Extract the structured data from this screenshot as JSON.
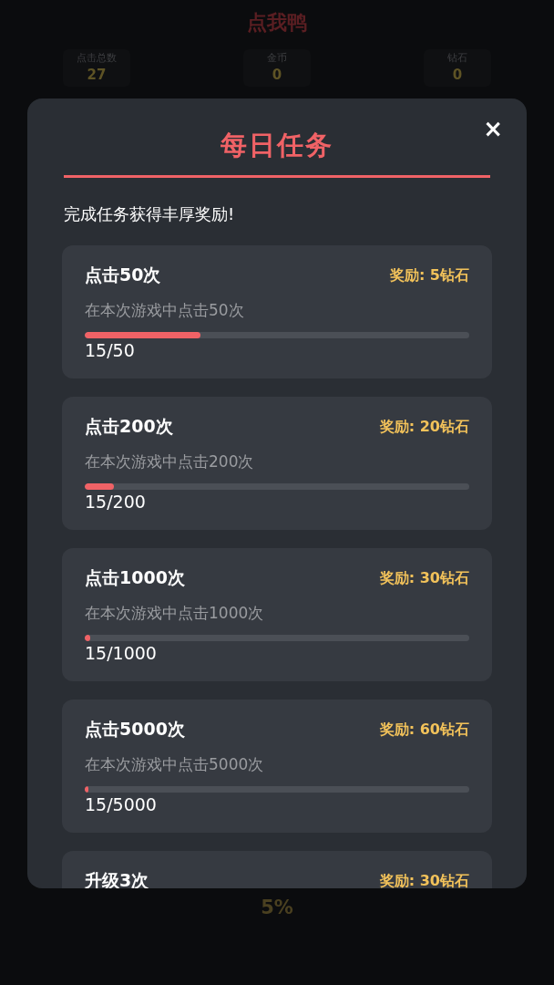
{
  "app_title": "点我鸭",
  "stats": [
    {
      "label": "点击总数",
      "value": "27"
    },
    {
      "label": "金币",
      "value": "0"
    },
    {
      "label": "钻石",
      "value": "0"
    }
  ],
  "progress_label": "5%",
  "modal": {
    "title": "每日任务",
    "close": "×",
    "subtitle": "完成任务获得丰厚奖励!",
    "tasks": [
      {
        "title": "点击50次",
        "reward": "奖励: 5钻石",
        "description": "在本次游戏中点击50次",
        "level": 0.3,
        "count": "15/50"
      },
      {
        "title": "点击200次",
        "reward": "奖励: 20钻石",
        "description": "在本次游戏中点击200次",
        "level": 0.075,
        "count": "15/200"
      },
      {
        "title": "点击1000次",
        "reward": "奖励: 30钻石",
        "description": "在本次游戏中点击1000次",
        "level": 0.015,
        "count": "15/1000"
      },
      {
        "title": "点击5000次",
        "reward": "奖励: 60钻石",
        "description": "在本次游戏中点击5000次",
        "level": 0.003,
        "count": "15/5000"
      },
      {
        "title": "升级3次",
        "reward": "奖励: 30钻石"
      }
    ]
  }
}
